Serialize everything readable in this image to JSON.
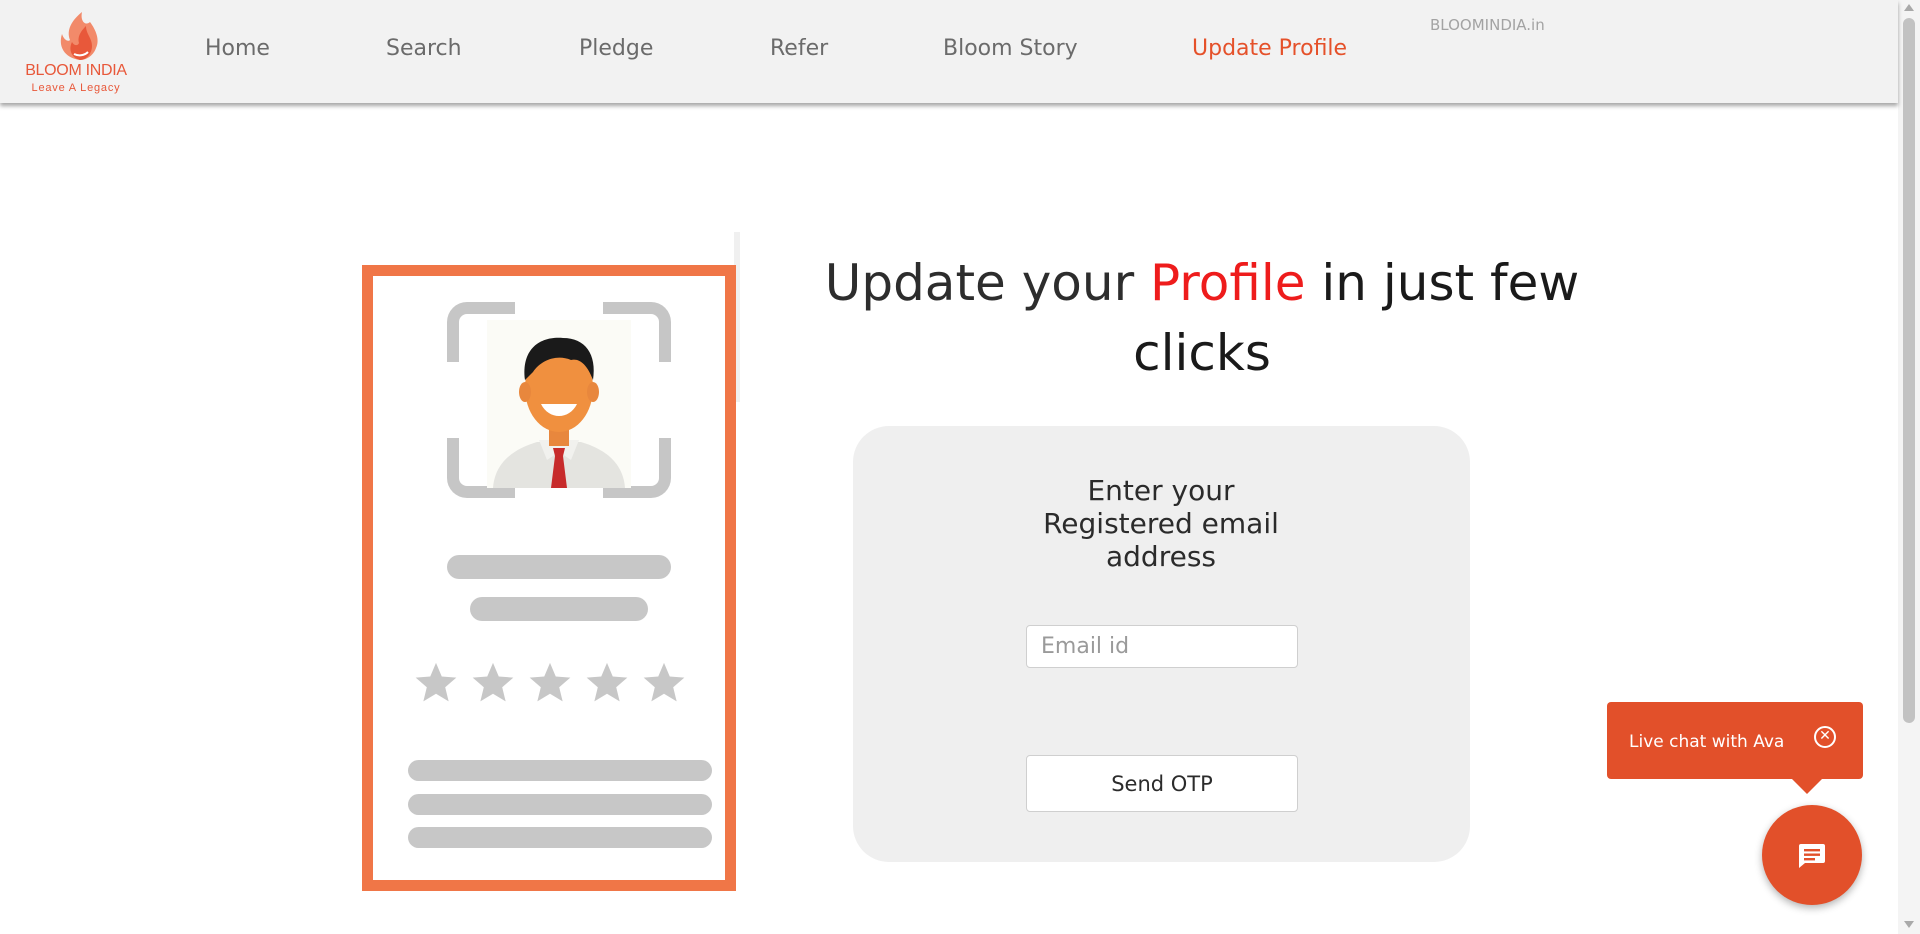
{
  "brand": {
    "name": "BLOOM INDIA",
    "tagline": "Leave A Legacy",
    "site_link": "BLOOMINDIA.in",
    "accent_color": "#e5512a"
  },
  "nav": {
    "items": [
      {
        "label": "Home"
      },
      {
        "label": "Search"
      },
      {
        "label": "Pledge"
      },
      {
        "label": "Refer"
      },
      {
        "label": "Bloom Story"
      },
      {
        "label": "Update Profile",
        "active": true
      }
    ]
  },
  "hero": {
    "title_part1": "Update your ",
    "title_accent": "Profile",
    "title_part2": " in just few",
    "title_part3": "clicks"
  },
  "form": {
    "title_line1": "Enter your",
    "title_line2": "Registered email",
    "title_line3": "address",
    "email": {
      "placeholder": "Email id",
      "value": ""
    },
    "submit_label": "Send OTP"
  },
  "illustration": {
    "rating": {
      "filled": 5,
      "max": 5
    }
  },
  "chat": {
    "label": "Live chat with Ava",
    "close_icon": "close-icon",
    "fab_icon": "chat-icon"
  }
}
